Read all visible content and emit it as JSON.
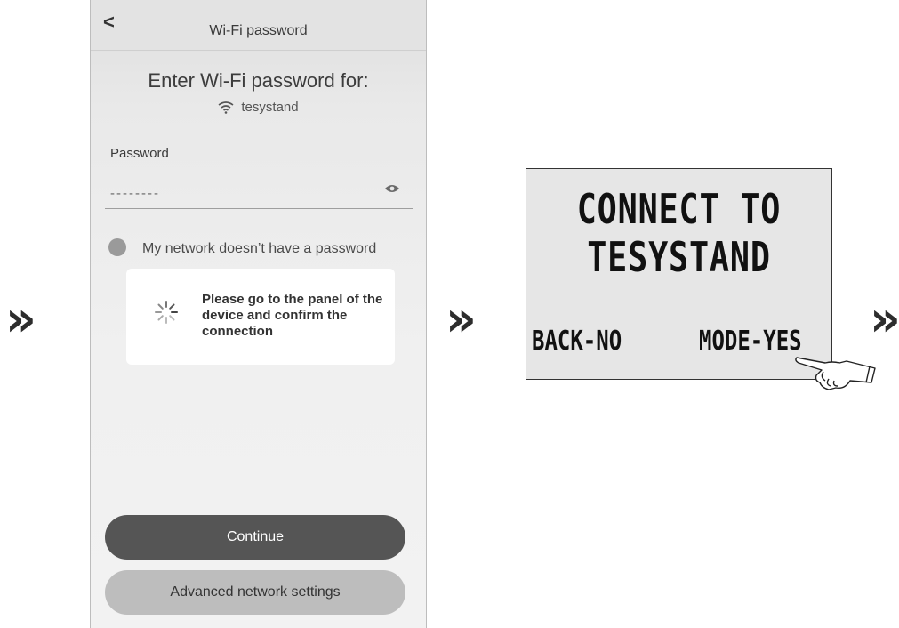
{
  "step_arrows": [
    "»",
    "»",
    "»"
  ],
  "phone": {
    "topbar": {
      "title": "Wi-Fi password",
      "back_glyph": "<"
    },
    "heading": "Enter Wi-Fi password for:",
    "ssid": "tesystand",
    "password": {
      "label": "Password",
      "value": "--------"
    },
    "no_password_option": "My network doesn’t have a password",
    "dialog": {
      "message": "Please go to the panel of the device and confirm the connection"
    },
    "buttons": {
      "continue": "Continue",
      "advanced": "Advanced network settings"
    }
  },
  "device_panel": {
    "line1": "CONNECT TO",
    "line2": "TESYSTAND",
    "back_option": "BACK-NO",
    "mode_option": "MODE-YES"
  },
  "colors": {
    "primary_button": "#555555",
    "secondary_button": "#bdbdbd",
    "lcd_background": "#e6e6e6"
  },
  "icons": [
    "chevron-left-icon",
    "wifi-icon",
    "eye-icon",
    "spinner-icon",
    "pointing-hand-icon"
  ]
}
